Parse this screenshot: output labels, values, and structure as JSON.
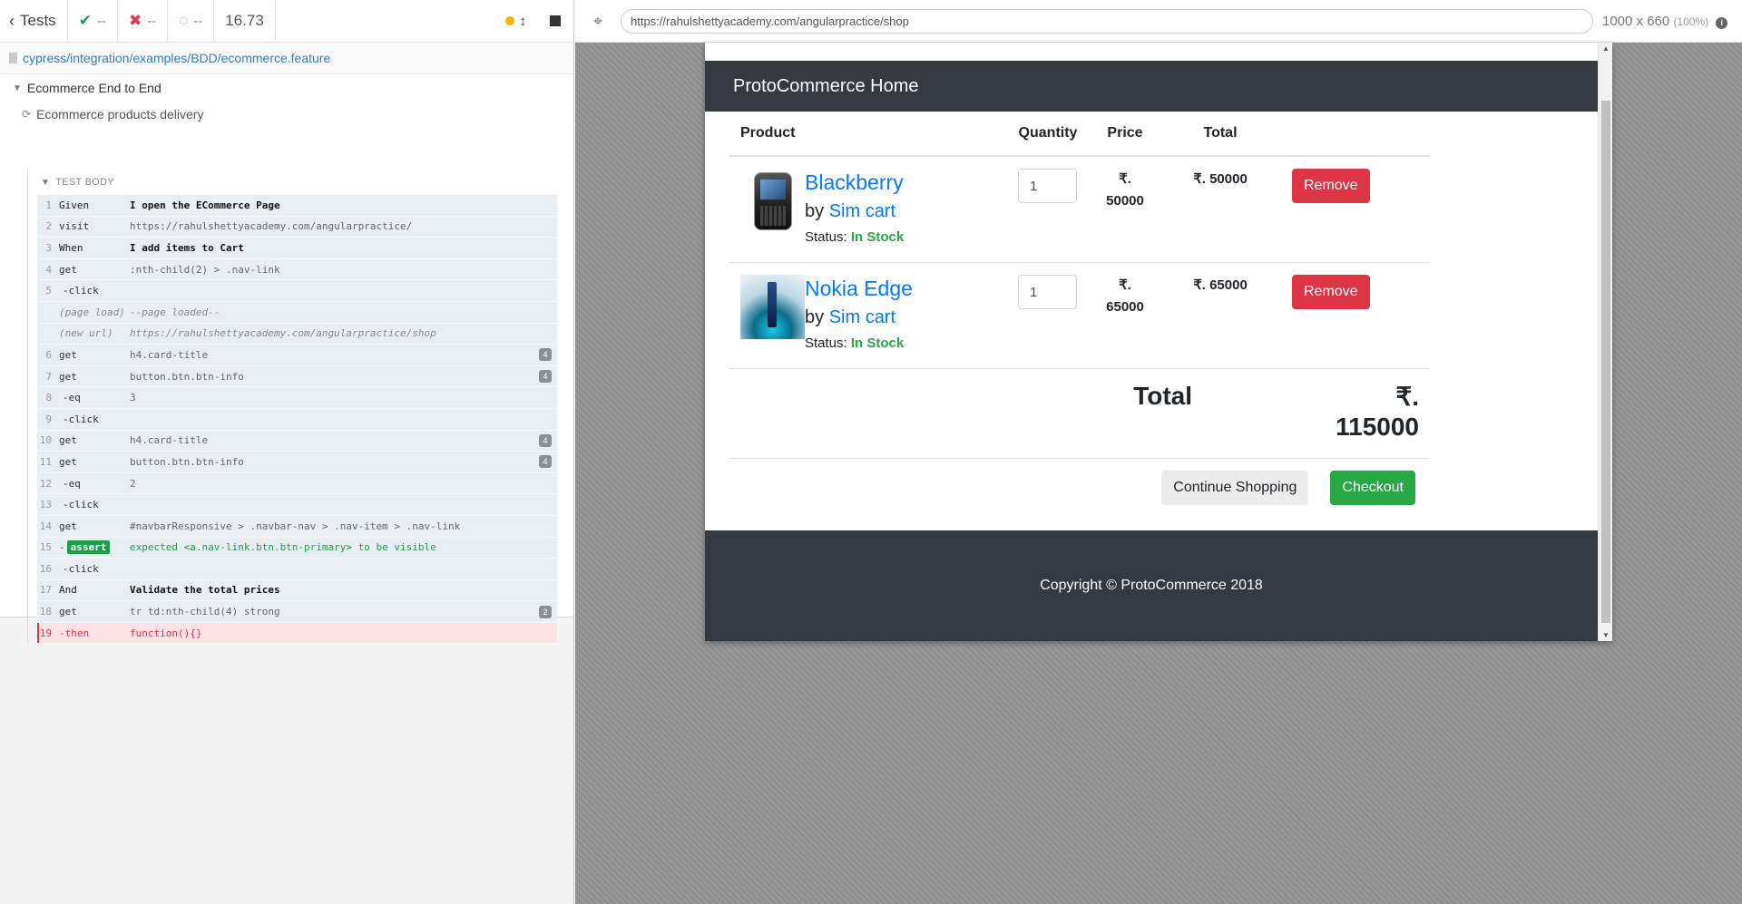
{
  "reporter": {
    "tests_label": "Tests",
    "passed": "--",
    "failed": "--",
    "pending": "--",
    "duration": "16.73",
    "spec_path": "cypress/integration/examples/BDD/ecommerce.feature",
    "suite_title": "Ecommerce End to End",
    "test_title": "Ecommerce products delivery",
    "test_body_label": "TEST BODY",
    "commands": [
      {
        "num": "1",
        "name": "Given",
        "msg": "I open the ECommerce Page",
        "kind": "step"
      },
      {
        "num": "2",
        "name": "visit",
        "msg": "https://rahulshettyacademy.com/angularpractice/",
        "kind": "cmd"
      },
      {
        "num": "3",
        "name": "When",
        "msg": "I add items to Cart",
        "kind": "step"
      },
      {
        "num": "4",
        "name": "get",
        "msg": ":nth-child(2) > .nav-link",
        "kind": "cmd"
      },
      {
        "num": "5",
        "name": "-click",
        "msg": "",
        "kind": "indent"
      },
      {
        "num": "",
        "name": "(page load)",
        "msg": "--page loaded--",
        "kind": "event"
      },
      {
        "num": "",
        "name": "(new url)",
        "msg": "https://rahulshettyacademy.com/angularpractice/shop",
        "kind": "event"
      },
      {
        "num": "6",
        "name": "get",
        "msg": "h4.card-title",
        "kind": "cmd",
        "badge": "4"
      },
      {
        "num": "7",
        "name": "get",
        "msg": "button.btn.btn-info",
        "kind": "cmd",
        "badge": "4"
      },
      {
        "num": "8",
        "name": "-eq",
        "msg": "3",
        "kind": "indent"
      },
      {
        "num": "9",
        "name": "-click",
        "msg": "",
        "kind": "indent"
      },
      {
        "num": "10",
        "name": "get",
        "msg": "h4.card-title",
        "kind": "cmd",
        "badge": "4"
      },
      {
        "num": "11",
        "name": "get",
        "msg": "button.btn.btn-info",
        "kind": "cmd",
        "badge": "4"
      },
      {
        "num": "12",
        "name": "-eq",
        "msg": "2",
        "kind": "indent"
      },
      {
        "num": "13",
        "name": "-click",
        "msg": "",
        "kind": "indent"
      },
      {
        "num": "14",
        "name": "get",
        "msg": "#navbarResponsive > .navbar-nav > .nav-item > .nav-link",
        "kind": "cmd"
      },
      {
        "num": "15",
        "name": "assert",
        "msg": "expected <a.nav-link.btn.btn-primary> to be visible",
        "kind": "assert"
      },
      {
        "num": "16",
        "name": "-click",
        "msg": "",
        "kind": "indent"
      },
      {
        "num": "17",
        "name": "And",
        "msg": "Validate the total prices",
        "kind": "step"
      },
      {
        "num": "18",
        "name": "get",
        "msg": "tr td:nth-child(4) strong",
        "kind": "cmd",
        "badge": "2"
      },
      {
        "num": "19",
        "name": "-then",
        "msg": "function(){}",
        "kind": "failed"
      }
    ]
  },
  "aut": {
    "url": "https://rahulshettyacademy.com/angularpractice/shop",
    "viewport": "1000 x 660",
    "scale": "(100%)"
  },
  "site": {
    "brand": "ProtoCommerce Home",
    "columns": {
      "product": "Product",
      "quantity": "Quantity",
      "price": "Price",
      "total": "Total"
    },
    "items": [
      {
        "title": "Blackberry",
        "by": "by",
        "seller": "Sim cart",
        "status_label": "Status:",
        "status": "In Stock",
        "qty": "1",
        "price_symbol": "₹.",
        "price": "50000",
        "total": "₹. 50000",
        "remove": "Remove"
      },
      {
        "title": "Nokia Edge",
        "by": "by",
        "seller": "Sim cart",
        "status_label": "Status:",
        "status": "In Stock",
        "qty": "1",
        "price_symbol": "₹.",
        "price": "65000",
        "total": "₹. 65000",
        "remove": "Remove"
      }
    ],
    "total_label": "Total",
    "total_symbol": "₹.",
    "total_value": "115000",
    "continue_shopping": "Continue Shopping",
    "checkout": "Checkout",
    "footer": "Copyright © ProtoCommerce 2018"
  },
  "colors": {
    "link_blue": "#007bff",
    "danger": "#dc3545",
    "success": "#28a745",
    "navbar": "#343a40",
    "cypress_fail": "#e0344a",
    "cypress_pass": "#1e9e4b"
  }
}
